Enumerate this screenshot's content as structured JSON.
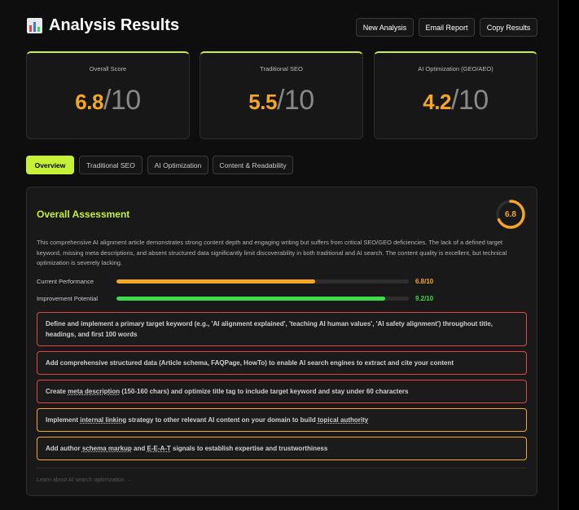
{
  "header": {
    "title": "Analysis Results",
    "icon": "bar-chart-icon",
    "buttons": {
      "new_analysis": "New Analysis",
      "email_report": "Email Report",
      "copy_results": "Copy Results"
    }
  },
  "scores": [
    {
      "label": "Overall Score",
      "value": "6.8",
      "max": "/10"
    },
    {
      "label": "Traditional SEO",
      "value": "5.5",
      "max": "/10"
    },
    {
      "label": "AI Optimization (GEO/AEO)",
      "value": "4.2",
      "max": "/10"
    }
  ],
  "tabs": [
    "Overview",
    "Traditional SEO",
    "AI Optimization",
    "Content & Readability"
  ],
  "active_tab": "Overview",
  "assessment": {
    "title": "Overall Assessment",
    "gauge_value": "6.8",
    "gauge_fraction": 0.68,
    "summary": "This comprehensive AI alignment article demonstrates strong content depth and engaging writing but suffers from critical SEO/GEO deficiencies. The lack of a defined target keyword, missing meta descriptions, and absent structured data significantly limit discoverability in both traditional and AI search. The content quality is excellent, but technical optimization is severely lacking.",
    "metrics": [
      {
        "label": "Current Performance",
        "value": "6.8/10",
        "fraction": 0.68,
        "color": "#f5a623"
      },
      {
        "label": "Improvement Potential",
        "value": "9.2/10",
        "fraction": 0.92,
        "color": "#3ddc4a"
      }
    ],
    "recommendations": [
      {
        "severity": "high",
        "text": "Define and implement a primary target keyword (e.g., 'AI alignment explained', 'teaching AI human values', 'AI safety alignment') throughout title, headings, and first 100 words"
      },
      {
        "severity": "high",
        "text": "Add comprehensive structured data (Article schema, FAQPage, HowTo) to enable AI search engines to extract and cite your content"
      },
      {
        "severity": "high",
        "text_parts": [
          "Create ",
          "meta description",
          " (150-160 chars) and optimize title tag to include target keyword and stay under 60 characters"
        ]
      },
      {
        "severity": "medium",
        "text_parts": [
          "Implement ",
          "internal linking",
          " strategy to other relevant AI content on your domain to build ",
          "topical authority"
        ]
      },
      {
        "severity": "medium",
        "text_parts": [
          "Add author ",
          "schema markup",
          " and ",
          "E-E-A-T",
          " signals to establish expertise and trustworthiness"
        ]
      }
    ],
    "learn_more": "Learn about AI search optimization →"
  },
  "colors": {
    "accent": "#c6f135",
    "score": "#f5a623",
    "success": "#3ddc4a",
    "danger": "#e0444b"
  }
}
